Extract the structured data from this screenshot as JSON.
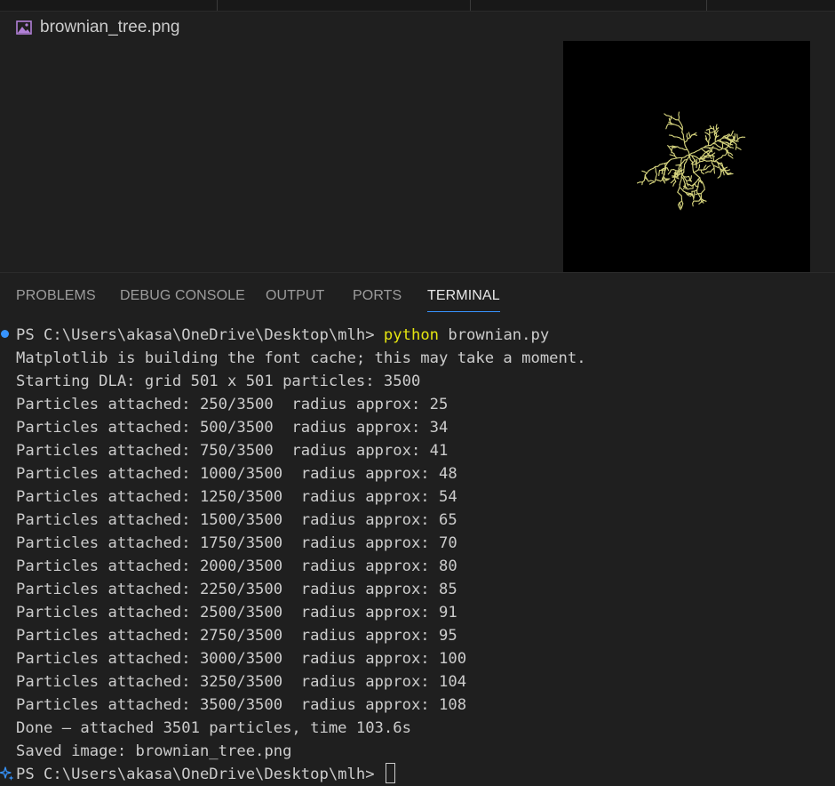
{
  "editor": {
    "file_name": "brownian_tree.png",
    "file_icon": "image-file-icon"
  },
  "panel": {
    "tabs": [
      {
        "label": "PROBLEMS",
        "active": false
      },
      {
        "label": "DEBUG CONSOLE",
        "active": false
      },
      {
        "label": "OUTPUT",
        "active": false
      },
      {
        "label": "PORTS",
        "active": false
      },
      {
        "label": "TERMINAL",
        "active": true
      }
    ]
  },
  "terminal": {
    "prompt": "PS C:\\Users\\akasa\\OneDrive\\Desktop\\mlh> ",
    "command_word": "python",
    "command_args": " brownian.py",
    "lines": [
      "Matplotlib is building the font cache; this may take a moment.",
      "Starting DLA: grid 501 x 501 particles: 3500",
      "Particles attached: 250/3500  radius approx: 25",
      "Particles attached: 500/3500  radius approx: 34",
      "Particles attached: 750/3500  radius approx: 41",
      "Particles attached: 1000/3500  radius approx: 48",
      "Particles attached: 1250/3500  radius approx: 54",
      "Particles attached: 1500/3500  radius approx: 65",
      "Particles attached: 1750/3500  radius approx: 70",
      "Particles attached: 2000/3500  radius approx: 80",
      "Particles attached: 2250/3500  radius approx: 85",
      "Particles attached: 2500/3500  radius approx: 91",
      "Particles attached: 2750/3500  radius approx: 95",
      "Particles attached: 3000/3500  radius approx: 100",
      "Particles attached: 3250/3500  radius approx: 104",
      "Particles attached: 3500/3500  radius approx: 108",
      "Done — attached 3501 particles, time 103.6s",
      "Saved image: brownian_tree.png"
    ],
    "final_prompt": "PS C:\\Users\\akasa\\OneDrive\\Desktop\\mlh> "
  },
  "colors": {
    "background": "#1f1f1f",
    "accent": "#3794ff",
    "command": "#e5e510",
    "tree": "#d6d47e"
  }
}
